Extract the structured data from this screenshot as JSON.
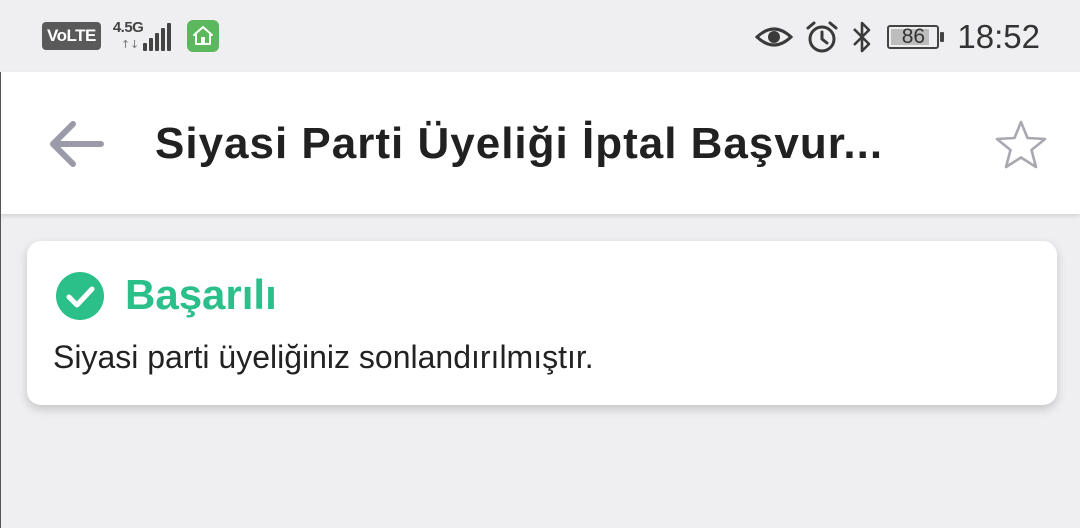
{
  "status_bar": {
    "volte_label": "VoLTE",
    "network_label": "4.5G",
    "network_arrows": "↑↓",
    "battery_level": "86",
    "battery_percent": 86,
    "time": "18:52",
    "icons": [
      "eye-icon",
      "alarm-icon",
      "bluetooth-icon"
    ]
  },
  "app_bar": {
    "back_icon": "arrow-left-icon",
    "title": "Siyasi Parti Üyeliği İptal Başvur...",
    "star_icon": "star-outline-icon"
  },
  "result_card": {
    "status_icon": "check-circle-icon",
    "status_title": "Başarılı",
    "message": "Siyasi parti üyeliğiniz sonlandırılmıştır."
  },
  "colors": {
    "success": "#2bbf8a",
    "background": "#efeff1",
    "app_bar": "#ffffff",
    "icon_gray": "#9a9aa8"
  }
}
